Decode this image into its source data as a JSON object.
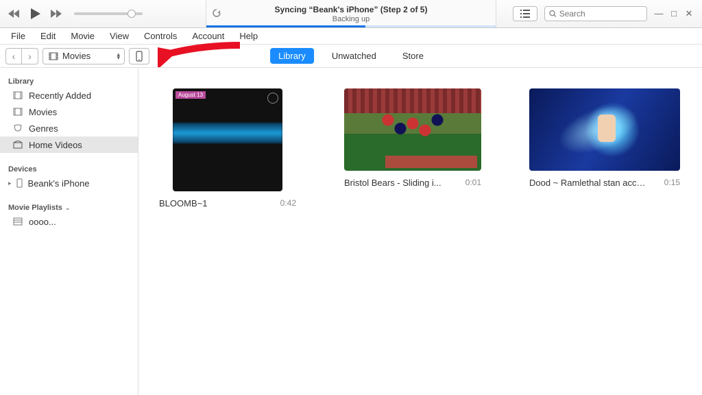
{
  "sync": {
    "title": "Syncing “Beank's iPhone” (Step 2 of 5)",
    "subtitle": "Backing up"
  },
  "search": {
    "placeholder": "Search"
  },
  "menus": [
    "File",
    "Edit",
    "Movie",
    "View",
    "Controls",
    "Account",
    "Help"
  ],
  "category": "Movies",
  "tabs": {
    "library": "Library",
    "unwatched": "Unwatched",
    "store": "Store"
  },
  "sidebar": {
    "libraryHdr": "Library",
    "items": [
      {
        "label": "Recently Added"
      },
      {
        "label": "Movies"
      },
      {
        "label": "Genres"
      },
      {
        "label": "Home Videos"
      }
    ],
    "devicesHdr": "Devices",
    "device": "Beank's iPhone",
    "playlistHdr": "Movie Playlists",
    "playlist": "oooo..."
  },
  "videos": [
    {
      "title": "BLOOMB~1",
      "duration": "0:42",
      "tag": "August  13"
    },
    {
      "title": "Bristol Bears - Sliding i...",
      "duration": "0:01"
    },
    {
      "title": "Dood ~ Ramlethal stan acco...",
      "duration": "0:15"
    }
  ]
}
